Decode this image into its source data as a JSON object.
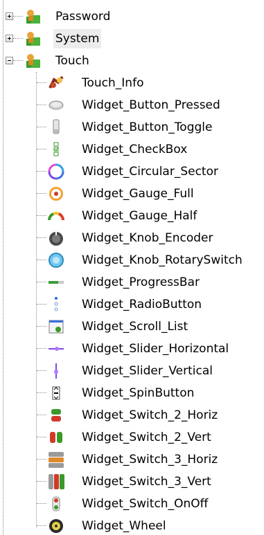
{
  "tree": {
    "top_nodes": [
      {
        "label": "Password",
        "expanded": false,
        "selected": false
      },
      {
        "label": "System",
        "expanded": false,
        "selected": true
      },
      {
        "label": "Touch",
        "expanded": true,
        "selected": false
      }
    ],
    "touch_children": [
      {
        "label": "Touch_Info",
        "icon": "touch-info-icon"
      },
      {
        "label": "Widget_Button_Pressed",
        "icon": "button-pressed-icon"
      },
      {
        "label": "Widget_Button_Toggle",
        "icon": "button-toggle-icon"
      },
      {
        "label": "Widget_CheckBox",
        "icon": "checkbox-icon"
      },
      {
        "label": "Widget_Circular_Sector",
        "icon": "circular-sector-icon"
      },
      {
        "label": "Widget_Gauge_Full",
        "icon": "gauge-full-icon"
      },
      {
        "label": "Widget_Gauge_Half",
        "icon": "gauge-half-icon"
      },
      {
        "label": "Widget_Knob_Encoder",
        "icon": "knob-encoder-icon"
      },
      {
        "label": "Widget_Knob_RotarySwitch",
        "icon": "knob-rotary-icon"
      },
      {
        "label": "Widget_ProgressBar",
        "icon": "progressbar-icon"
      },
      {
        "label": "Widget_RadioButton",
        "icon": "radiobutton-icon"
      },
      {
        "label": "Widget_Scroll_List",
        "icon": "scroll-list-icon"
      },
      {
        "label": "Widget_Slider_Horizontal",
        "icon": "slider-horizontal-icon"
      },
      {
        "label": "Widget_Slider_Vertical",
        "icon": "slider-vertical-icon"
      },
      {
        "label": "Widget_SpinButton",
        "icon": "spinbutton-icon"
      },
      {
        "label": "Widget_Switch_2_Horiz",
        "icon": "switch-2-horiz-icon"
      },
      {
        "label": "Widget_Switch_2_Vert",
        "icon": "switch-2-vert-icon"
      },
      {
        "label": "Widget_Switch_3_Horiz",
        "icon": "switch-3-horiz-icon"
      },
      {
        "label": "Widget_Switch_3_Vert",
        "icon": "switch-3-vert-icon"
      },
      {
        "label": "Widget_Switch_OnOff",
        "icon": "switch-onoff-icon"
      },
      {
        "label": "Widget_Wheel",
        "icon": "wheel-icon"
      }
    ]
  },
  "colors": {
    "selection": "#ececec",
    "guide_lines": "#8c8c8c",
    "folder_orange": "#e8a23a",
    "folder_green": "#3a9a2a"
  }
}
